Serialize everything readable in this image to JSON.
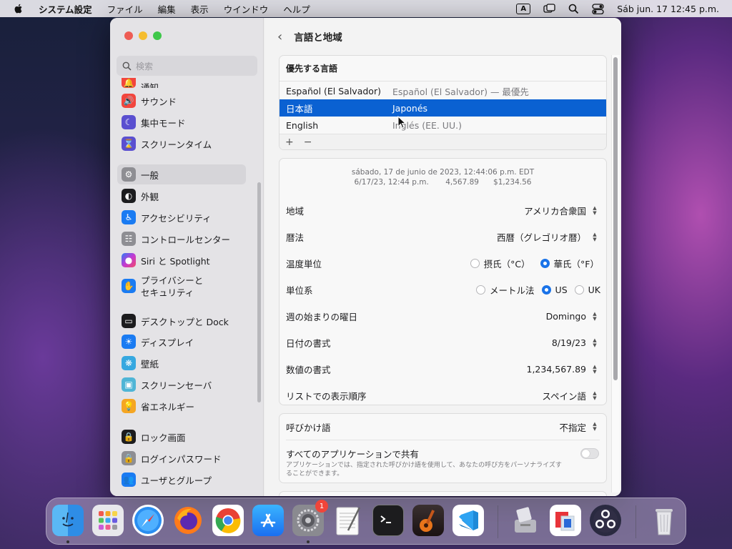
{
  "menubar": {
    "app_name": "システム設定",
    "menus": [
      "ファイル",
      "編集",
      "表示",
      "ウインドウ",
      "ヘルプ"
    ],
    "input_indicator": "A",
    "clock": "Sáb jun. 17  12:45 p.m."
  },
  "sidebar": {
    "search_placeholder": "検索",
    "items": [
      {
        "label": "通知",
        "icon": "bell-icon",
        "color": "#f2453d"
      },
      {
        "label": "サウンド",
        "icon": "speaker-icon",
        "color": "#f2453d"
      },
      {
        "label": "集中モード",
        "icon": "moon-icon",
        "color": "#5a4fd0"
      },
      {
        "label": "スクリーンタイム",
        "icon": "hourglass-icon",
        "color": "#5a4fd0"
      },
      {
        "label": "一般",
        "icon": "gear-icon",
        "color": "#8e8e93"
      },
      {
        "label": "外観",
        "icon": "appearance-icon",
        "color": "#1c1c1e"
      },
      {
        "label": "アクセシビリティ",
        "icon": "accessibility-icon",
        "color": "#1a7bf2"
      },
      {
        "label": "コントロールセンター",
        "icon": "toggles-icon",
        "color": "#8e8e93"
      },
      {
        "label": "Siri と Spotlight",
        "icon": "siri-icon",
        "color": "#9b3fd4"
      },
      {
        "label": "プライバシーと\nセキュリティ",
        "label_line1": "プライバシーと",
        "label_line2": "セキュリティ",
        "icon": "hand-icon",
        "color": "#1a7bf2"
      },
      {
        "label": "デスクトップと Dock",
        "icon": "dock-icon",
        "color": "#1c1c1e"
      },
      {
        "label": "ディスプレイ",
        "icon": "sun-icon",
        "color": "#1a7bf2"
      },
      {
        "label": "壁紙",
        "icon": "wallpaper-icon",
        "color": "#36a8e0"
      },
      {
        "label": "スクリーンセーバ",
        "icon": "screensaver-icon",
        "color": "#4fb5d6"
      },
      {
        "label": "省エネルギー",
        "icon": "bulb-icon",
        "color": "#f5a623"
      },
      {
        "label": "ロック画面",
        "icon": "lock-icon",
        "color": "#1c1c1e"
      },
      {
        "label": "ログインパスワード",
        "icon": "lock-icon",
        "color": "#8e8e93"
      },
      {
        "label": "ユーザとグループ",
        "icon": "users-icon",
        "color": "#1a7bf2"
      }
    ]
  },
  "main": {
    "back_label": "‹",
    "title": "言語と地域",
    "languages": {
      "header": "優先する言語",
      "rows": [
        {
          "name": "Español (El Salvador)",
          "detail": "Español (El Salvador) — 最優先"
        },
        {
          "name": "日本語",
          "detail": "Japonés"
        },
        {
          "name": "English",
          "detail": "Inglés (EE. UU.)"
        }
      ],
      "add": "+",
      "remove": "−"
    },
    "sample_line1": "sábado, 17 de junio de 2023, 12:44:06 p.m. EDT",
    "sample_line2": "6/17/23, 12:44 p.m.       4,567.89      $1,234.56",
    "region_label": "地域",
    "region_value": "アメリカ合衆国",
    "calendar_label": "暦法",
    "calendar_value": "西暦（グレゴリオ暦）",
    "temp_label": "温度単位",
    "temp_c": "摂氏（°C）",
    "temp_f": "華氏（°F）",
    "measure_label": "単位系",
    "measure_metric": "メートル法",
    "measure_us": "US",
    "measure_uk": "UK",
    "weekstart_label": "週の始まりの曜日",
    "weekstart_value": "Domingo",
    "date_label": "日付の書式",
    "date_value": "8/19/23",
    "number_label": "数値の書式",
    "number_value": "1,234,567.89",
    "sort_label": "リストでの表示順序",
    "sort_value": "スペイン語",
    "address_label": "呼びかけ語",
    "address_value": "不指定",
    "share_label": "すべてのアプリケーションで共有",
    "share_desc": "アプリケーションでは、指定された呼びかけ語を使用して、あなたの呼び方をパーソナライズすることができます。"
  },
  "dock": {
    "badge": "1",
    "apps": [
      "finder-icon",
      "launchpad-icon",
      "safari-icon",
      "firefox-icon",
      "chrome-icon",
      "appstore-icon",
      "system-settings-icon",
      "textedit-icon",
      "terminal-icon",
      "garageband-icon",
      "vscode-icon",
      "migration-icon",
      "parallels-icon",
      "obs-icon",
      "trash-icon"
    ]
  }
}
